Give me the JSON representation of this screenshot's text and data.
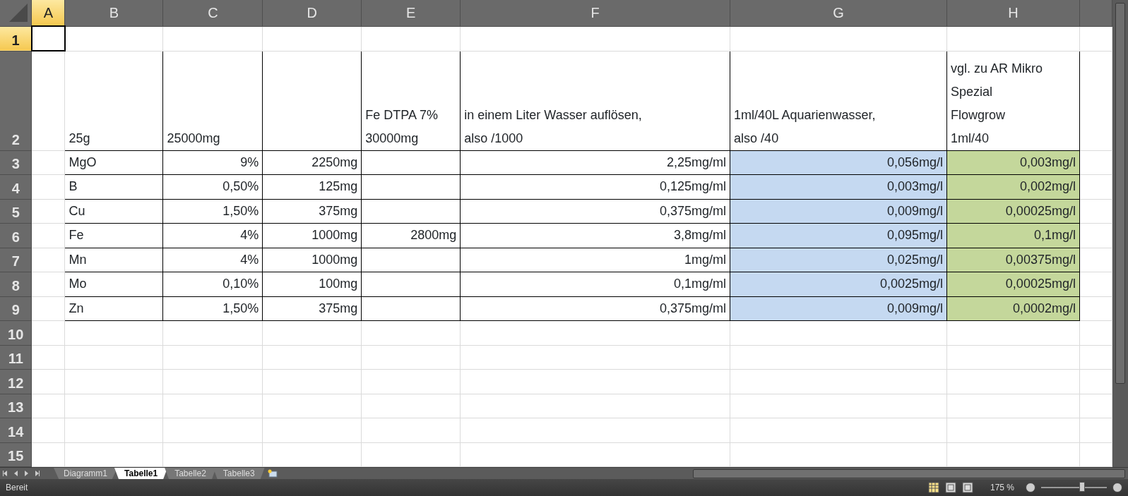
{
  "sheet": {
    "columns": [
      {
        "label": "A",
        "selected": true
      },
      {
        "label": "B",
        "selected": false
      },
      {
        "label": "C",
        "selected": false
      },
      {
        "label": "D",
        "selected": false
      },
      {
        "label": "E",
        "selected": false
      },
      {
        "label": "F",
        "selected": false
      },
      {
        "label": "G",
        "selected": false
      },
      {
        "label": "H",
        "selected": false
      }
    ],
    "rows": [
      {
        "label": "1",
        "selected": true
      },
      {
        "label": "2",
        "selected": false
      },
      {
        "label": "3",
        "selected": false
      },
      {
        "label": "4",
        "selected": false
      },
      {
        "label": "5",
        "selected": false
      },
      {
        "label": "6",
        "selected": false
      },
      {
        "label": "7",
        "selected": false
      },
      {
        "label": "8",
        "selected": false
      },
      {
        "label": "9",
        "selected": false
      },
      {
        "label": "10",
        "selected": false
      },
      {
        "label": "11",
        "selected": false
      },
      {
        "label": "12",
        "selected": false
      },
      {
        "label": "13",
        "selected": false
      },
      {
        "label": "14",
        "selected": false
      },
      {
        "label": "15",
        "selected": false
      }
    ]
  },
  "table": {
    "columns": [
      {
        "heading": "25g"
      },
      {
        "heading": "25000mg"
      },
      {},
      {
        "heading": "Fe DTPA 7%\n30000mg"
      },
      {
        "heading": "in einem Liter Wasser auflösen,\nalso /1000"
      },
      {
        "heading": "1ml/40L Aquarienwasser,\nalso /40",
        "color": "#c5d9f1"
      },
      {
        "heading": "vgl. zu AR Mikro\nSpezial\nFlowgrow\n1ml/40",
        "color": "#c4d79b"
      }
    ],
    "rows": [
      [
        "MgO",
        "9%",
        "2250mg",
        null,
        "2,25mg/ml",
        "0,056mg/l",
        "0,003mg/l"
      ],
      [
        "B",
        "0,50%",
        "125mg",
        null,
        "0,125mg/ml",
        "0,003mg/l",
        "0,002mg/l"
      ],
      [
        "Cu",
        "1,50%",
        "375mg",
        null,
        "0,375mg/ml",
        "0,009mg/l",
        "0,00025mg/l"
      ],
      [
        "Fe",
        "4%",
        "1000mg",
        "2800mg",
        "3,8mg/ml",
        "0,095mg/l",
        "0,1mg/l"
      ],
      [
        "Mn",
        "4%",
        "1000mg",
        null,
        "1mg/ml",
        "0,025mg/l",
        "0,00375mg/l"
      ],
      [
        "Mo",
        "0,10%",
        "100mg",
        null,
        "0,1mg/ml",
        "0,0025mg/l",
        "0,00025mg/l"
      ],
      [
        "Zn",
        "1,50%",
        "375mg",
        null,
        "0,375mg/ml",
        "0,009mg/l",
        "0,0002mg/l"
      ]
    ]
  },
  "sheet_tabs": [
    {
      "label": "Diagramm1",
      "selected": false
    },
    {
      "label": "Tabelle1",
      "selected": true
    },
    {
      "label": "Tabelle2",
      "selected": false
    },
    {
      "label": "Tabelle3",
      "selected": false
    }
  ],
  "status_bar": {
    "status": "Bereit",
    "zoom": "175 %",
    "zoom_slider": {
      "level": 0.62
    }
  }
}
